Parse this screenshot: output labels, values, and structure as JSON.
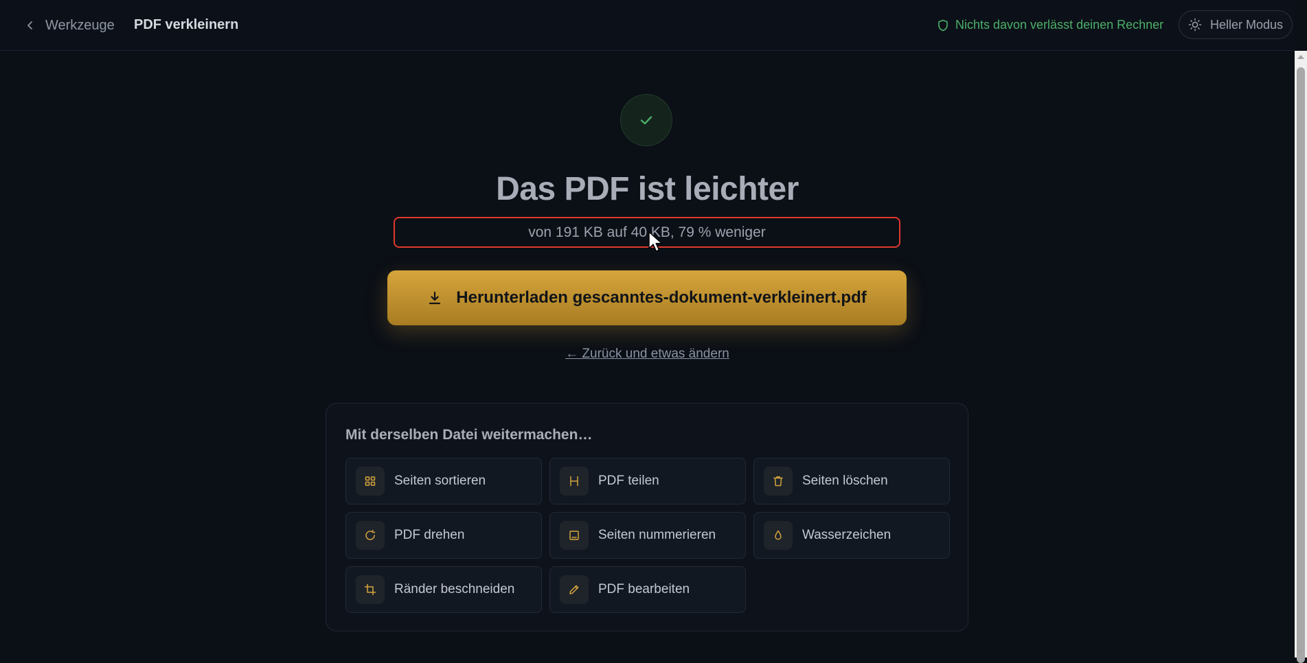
{
  "header": {
    "back_label": "Werkzeuge",
    "page_title": "PDF verkleinern",
    "privacy_note": "Nichts davon verlässt deinen Rechner",
    "theme_toggle_label": "Heller Modus"
  },
  "result": {
    "title": "Das PDF ist leichter",
    "stats": "von 191 KB auf 40 KB, 79 % weniger",
    "download_label": "Herunterladen gescanntes-dokument-verkleinert.pdf",
    "back_change_label": "← Zurück und etwas ändern"
  },
  "continue": {
    "title": "Mit derselben Datei weitermachen…",
    "tools": [
      {
        "label": "Seiten sortieren",
        "icon": "grid-icon"
      },
      {
        "label": "PDF teilen",
        "icon": "split-icon"
      },
      {
        "label": "Seiten löschen",
        "icon": "trash-icon"
      },
      {
        "label": "PDF drehen",
        "icon": "rotate-icon"
      },
      {
        "label": "Seiten nummerieren",
        "icon": "page-number-icon"
      },
      {
        "label": "Wasserzeichen",
        "icon": "droplet-icon"
      },
      {
        "label": "Ränder beschneiden",
        "icon": "crop-icon"
      },
      {
        "label": "PDF bearbeiten",
        "icon": "pencil-icon"
      }
    ]
  },
  "colors": {
    "accent": "#d6a53c",
    "success": "#4caf68",
    "background": "#0b0f16",
    "highlight_border": "#e0392d"
  }
}
